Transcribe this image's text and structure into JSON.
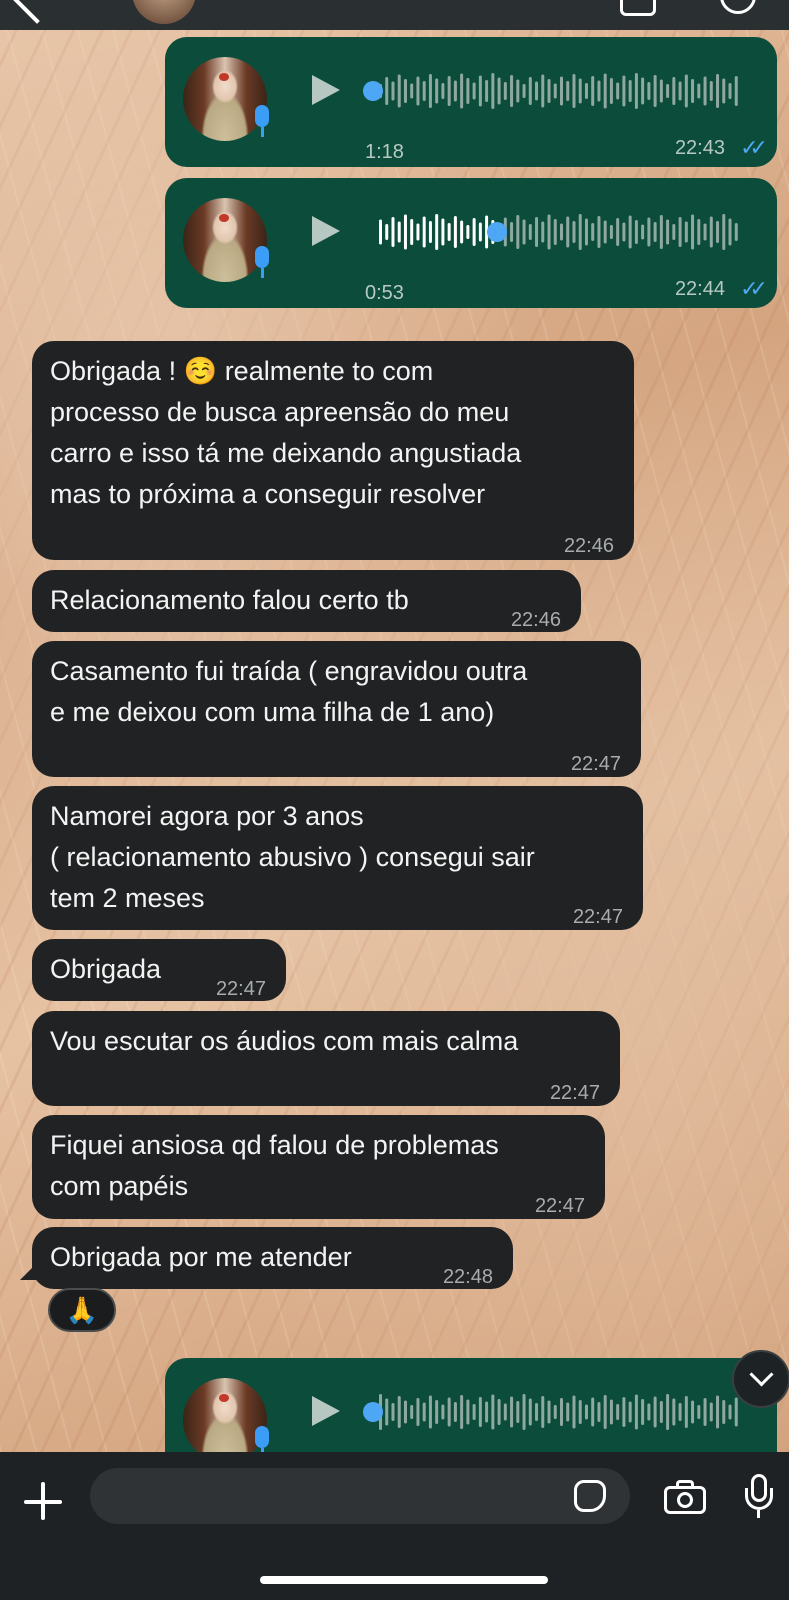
{
  "colors": {
    "outgoing_bubble": "#0b4d3a",
    "incoming_bubble": "#202223",
    "read_check": "#4ea7f5",
    "composer_bar": "#1f2224"
  },
  "voice_messages": [
    {
      "duration": "1:18",
      "time": "22:43",
      "status_icon": "double-check-read",
      "progress": 0.0
    },
    {
      "duration": "0:53",
      "time": "22:44",
      "status_icon": "double-check-read",
      "progress": 0.32
    },
    {
      "duration": "",
      "time": "",
      "status_icon": "",
      "progress": 0.0
    }
  ],
  "messages": [
    {
      "text": "Obrigada ! ☺️ realmente to com\nprocesso de busca apreensão do meu\ncarro e isso tá me deixando angustiada\nmas to próxima a conseguir resolver",
      "time": "22:46"
    },
    {
      "text": "Relacionamento falou certo tb",
      "time": "22:46"
    },
    {
      "text": "Casamento fui traída ( engravidou outra\ne me deixou com uma filha de 1 ano)",
      "time": "22:47"
    },
    {
      "text": "Namorei agora por 3 anos\n( relacionamento abusivo ) consegui sair\ntem 2 meses",
      "time": "22:47"
    },
    {
      "text": "Obrigada",
      "time": "22:47"
    },
    {
      "text": "Vou escutar os áudios com mais calma",
      "time": "22:47"
    },
    {
      "text": "Fiquei ansiosa qd falou de problemas\ncom papéis",
      "time": "22:47"
    },
    {
      "text": "Obrigada por me atender",
      "time": "22:48"
    }
  ],
  "reaction": {
    "emoji": "🙏",
    "icon": "praying-hands-icon"
  },
  "composer": {
    "input_value": "",
    "icons": [
      "plus-icon",
      "sticker-icon",
      "camera-icon",
      "microphone-icon"
    ]
  }
}
